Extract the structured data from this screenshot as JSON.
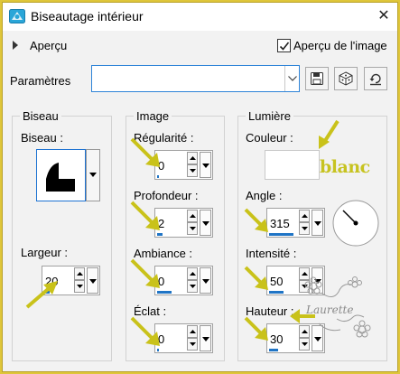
{
  "window": {
    "title": "Biseautage intérieur",
    "close_glyph": "✕"
  },
  "preview": {
    "label": "Aperçu",
    "show_image_label": "Aperçu de l'image",
    "show_image_checked": true
  },
  "presets": {
    "label": "Paramètres",
    "value": ""
  },
  "groups": {
    "biseau": {
      "title": "Biseau",
      "shape_label": "Biseau :",
      "width_label": "Largeur :",
      "width_value": "20",
      "width_fill": 0.2
    },
    "image": {
      "title": "Image",
      "fields": [
        {
          "label": "Régularité :",
          "value": "0",
          "fill": 0.0
        },
        {
          "label": "Profondeur :",
          "value": "2",
          "fill": 0.2
        },
        {
          "label": "Ambiance :",
          "value": "0",
          "fill": 0.5
        },
        {
          "label": "Éclat :",
          "value": "0",
          "fill": 0.0
        }
      ]
    },
    "lumiere": {
      "title": "Lumière",
      "color_label": "Couleur :",
      "color_hex": "#ffffff",
      "color_note": "blanc",
      "angle_label": "Angle :",
      "angle_value": "315",
      "angle_fill": 0.875,
      "intensity_label": "Intensité :",
      "intensity_value": "50",
      "intensity_fill": 0.5,
      "height_label": "Hauteur :",
      "height_value": "30",
      "height_fill": 0.33
    }
  },
  "watermark": {
    "text": "Laurette"
  },
  "colors": {
    "accent": "#1f74c5",
    "highlight_arrow": "#c9c21a",
    "frame": "#dfc63a"
  }
}
